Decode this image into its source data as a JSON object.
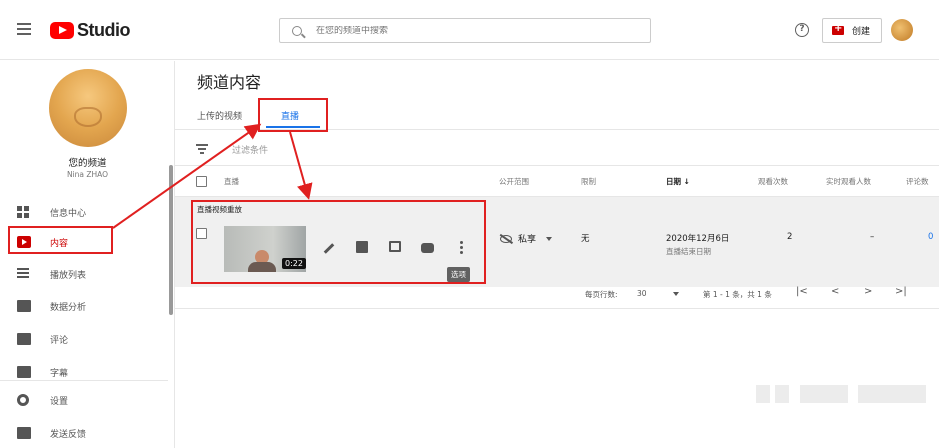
{
  "app": {
    "brand": "Studio"
  },
  "search": {
    "placeholder": "在您的频道中搜索"
  },
  "header": {
    "help": "?",
    "create_label": "创建"
  },
  "channel": {
    "name": "您的频道",
    "owner": "Nina ZHAO"
  },
  "sidebar": {
    "items": [
      {
        "label": "信息中心",
        "icon": "dashboard-icon"
      },
      {
        "label": "内容",
        "icon": "content-icon",
        "active": true
      },
      {
        "label": "播放列表",
        "icon": "playlist-icon"
      },
      {
        "label": "数据分析",
        "icon": "analytics-icon"
      },
      {
        "label": "评论",
        "icon": "comments-icon"
      },
      {
        "label": "字幕",
        "icon": "subtitles-icon"
      },
      {
        "label": "设置",
        "icon": "gear-icon"
      },
      {
        "label": "发送反馈",
        "icon": "feedback-icon"
      }
    ]
  },
  "main": {
    "title": "频道内容",
    "tabs": [
      {
        "label": "上传的视频"
      },
      {
        "label": "直播",
        "active": true
      }
    ],
    "filter_placeholder": "过滤条件",
    "columns": {
      "item": "直播",
      "visibility": "公开范围",
      "restriction": "限制",
      "date": "日期 ↓",
      "views": "观看次数",
      "live_viewers": "实时观看人数",
      "comments": "评论数"
    },
    "group_label": "直播视频重放",
    "row": {
      "duration": "0:22",
      "visibility": "私享",
      "restriction": "无",
      "date": "2020年12月6日",
      "date_sub": "直播结束日期",
      "views": "2",
      "live_viewers": "–",
      "comments": "0"
    },
    "tooltip": "选项",
    "pagination": {
      "rows_per_page_label": "每页行数:",
      "rows_per_page": "30",
      "range": "第 1 - 1 条，共 1 条",
      "first": "|<",
      "prev": "<",
      "next": ">",
      "last": ">|"
    }
  },
  "colors": {
    "accent": "#1a73e8",
    "brand_red": "#ff0000",
    "annotation_red": "#e02020"
  }
}
